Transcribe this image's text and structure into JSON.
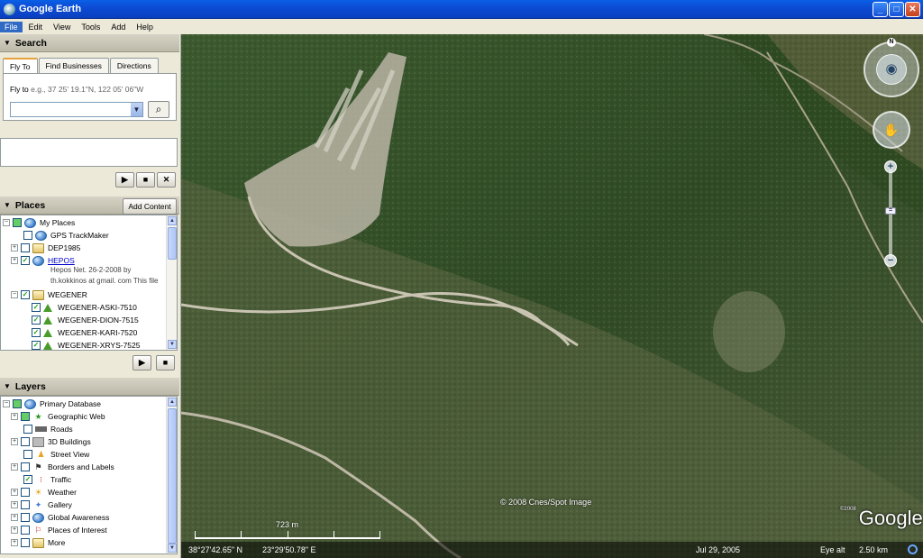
{
  "window": {
    "title": "Google Earth"
  },
  "menu": [
    "File",
    "Edit",
    "View",
    "Tools",
    "Add",
    "Help"
  ],
  "search": {
    "header": "Search",
    "tabs": [
      "Fly To",
      "Find Businesses",
      "Directions"
    ],
    "fly_label": "Fly to",
    "fly_hint": "e.g., 37 25' 19.1\"N, 122 05' 06\"W",
    "input_value": ""
  },
  "places": {
    "header": "Places",
    "add_content": "Add Content",
    "items": [
      {
        "label": "My Places"
      },
      {
        "label": "GPS TrackMaker"
      },
      {
        "label": "DEP1985"
      },
      {
        "label": "HEPOS",
        "desc1": "Hepos Net. 26-2-2008 by",
        "desc2": "th.kokkinos at gmail. com This file"
      },
      {
        "label": "WEGENER"
      },
      {
        "label": "WEGENER-ASKI-7510"
      },
      {
        "label": "WEGENER-DION-7515"
      },
      {
        "label": "WEGENER-KARI-7520"
      },
      {
        "label": "WEGENER-XRYS-7525"
      }
    ]
  },
  "layers": {
    "header": "Layers",
    "items": [
      {
        "label": "Primary Database"
      },
      {
        "label": "Geographic Web"
      },
      {
        "label": "Roads"
      },
      {
        "label": "3D Buildings"
      },
      {
        "label": "Street View"
      },
      {
        "label": "Borders and Labels"
      },
      {
        "label": "Traffic"
      },
      {
        "label": "Weather"
      },
      {
        "label": "Gallery"
      },
      {
        "label": "Global Awareness"
      },
      {
        "label": "Places of Interest"
      },
      {
        "label": "More"
      }
    ]
  },
  "map": {
    "copyright": "© 2008 Cnes/Spot Image",
    "logo": "Google",
    "logo_year": "©2008",
    "scale_label": "723 m",
    "compass_north": "N",
    "status": {
      "lat": "38°27'42.65\" N",
      "lon": "23°29'50.78\" E",
      "date": "Jul 29, 2005",
      "eye_alt_label": "Eye alt",
      "eye_alt": "2.50 km"
    }
  }
}
